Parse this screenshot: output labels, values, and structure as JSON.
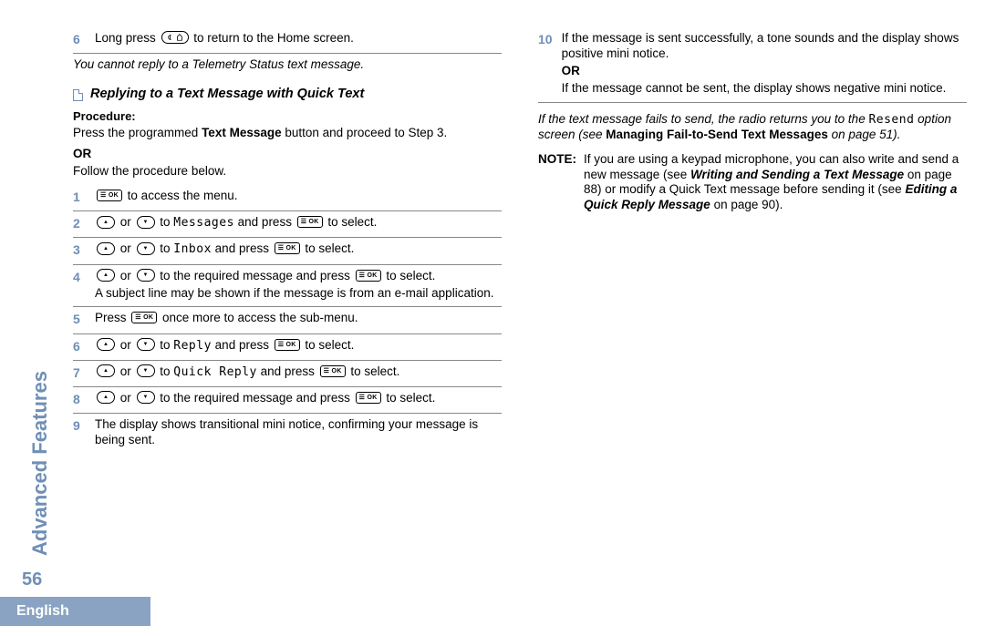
{
  "sidebar_title": "Advanced Features",
  "page_number": "56",
  "footer_lang": "English",
  "col_left": {
    "prelim_step_num": "6",
    "prelim_step_a": "Long press ",
    "prelim_step_b": " to return to the Home screen.",
    "telemetry_note": "You cannot reply to a Telemetry Status text message.",
    "section_title": "Replying to a Text Message with Quick Text",
    "procedure_label": "Procedure:",
    "proc_intro_a": "Press the programmed ",
    "proc_intro_b": "Text Message",
    "proc_intro_c": " button and proceed to Step 3.",
    "or_label": "OR",
    "proc_follow": "Follow the procedure below.",
    "steps": [
      {
        "n": "1",
        "parts": [
          "",
          " to access the menu."
        ]
      },
      {
        "n": "2",
        "parts": [
          "",
          " or ",
          " to ",
          "Messages",
          " and press ",
          " to select."
        ]
      },
      {
        "n": "3",
        "parts": [
          "",
          " or ",
          " to ",
          "Inbox",
          " and press ",
          " to select."
        ]
      },
      {
        "n": "4",
        "parts": [
          "",
          " or ",
          " to the required message and press ",
          " to select."
        ],
        "extra": "A subject line may be shown if the message is from an e-mail application."
      },
      {
        "n": "5",
        "parts": [
          "Press ",
          " once more to access the sub-menu."
        ]
      },
      {
        "n": "6",
        "parts": [
          "",
          " or ",
          " to ",
          "Reply",
          " and press ",
          " to select."
        ]
      },
      {
        "n": "7",
        "parts": [
          "",
          " or ",
          " to ",
          "Quick Reply",
          " and press ",
          " to select."
        ]
      },
      {
        "n": "8",
        "parts": [
          "",
          " or ",
          " to the required message and press ",
          " to select."
        ]
      },
      {
        "n": "9",
        "text": "The display shows transitional mini notice, confirming your message is being sent."
      }
    ]
  },
  "col_right": {
    "step10_num": "10",
    "step10_a": "If the message is sent successfully, a tone sounds and the display shows positive mini notice.",
    "step10_or": "OR",
    "step10_b": "If the message cannot be sent, the display shows negative mini notice.",
    "fail_a": "If the text message fails to send, the radio returns you to the ",
    "fail_resend": "Resend",
    "fail_b": " option screen (see ",
    "fail_bold": "Managing Fail-to-Send Text Messages",
    "fail_c": " on page 51).",
    "note_label": "NOTE:",
    "note_a": "If you are using a keypad microphone, you can also write and send a new message (see ",
    "note_bold1": "Writing and Sending a Text Message",
    "note_b": " on page 88) or modify a Quick Text message before sending it (see ",
    "note_bold2": "Editing a Quick Reply Message",
    "note_c": " on page 90)."
  }
}
